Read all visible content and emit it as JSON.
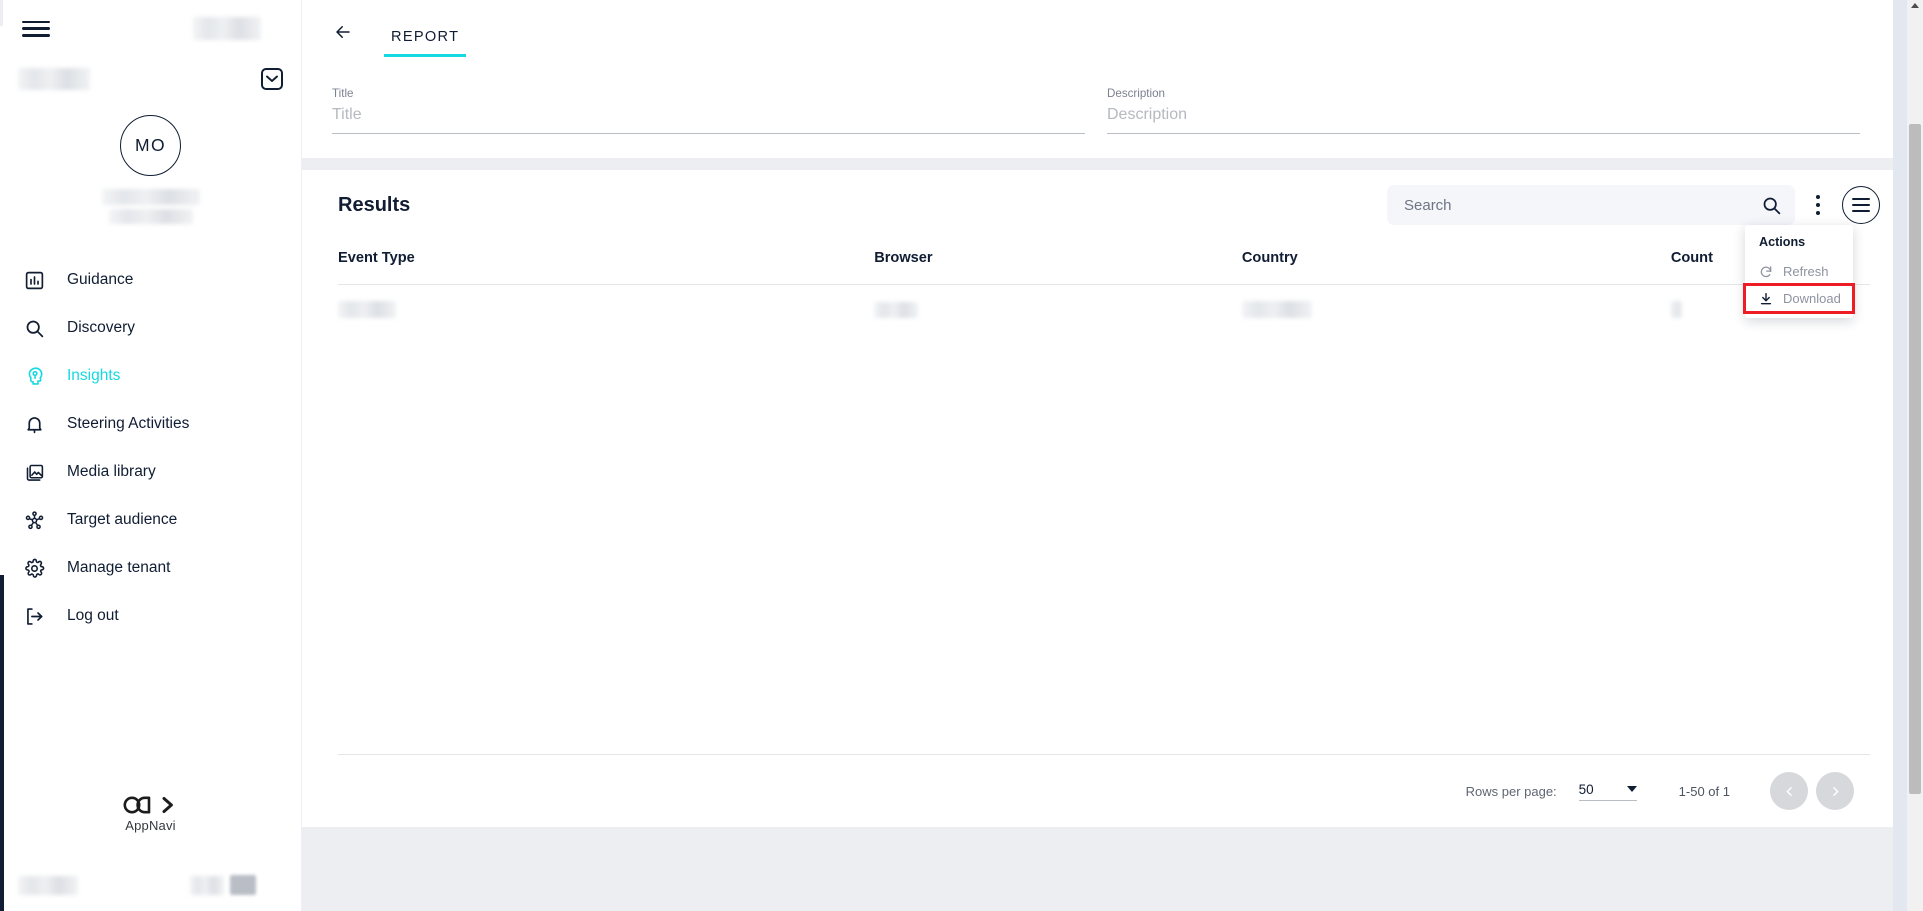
{
  "sidebar": {
    "menu_icon": "hamburger-icon",
    "collapse_icon": "chevron-down-icon",
    "avatar_initials": "MO",
    "items": [
      {
        "label": "Guidance",
        "icon": "bar-chart-icon",
        "active": false
      },
      {
        "label": "Discovery",
        "icon": "search-icon",
        "active": false
      },
      {
        "label": "Insights",
        "icon": "brain-head-icon",
        "active": true
      },
      {
        "label": "Steering Activities",
        "icon": "bell-icon",
        "active": false
      },
      {
        "label": "Media library",
        "icon": "image-gallery-icon",
        "active": false
      },
      {
        "label": "Target audience",
        "icon": "network-nodes-icon",
        "active": false
      },
      {
        "label": "Manage tenant",
        "icon": "gear-icon",
        "active": false
      },
      {
        "label": "Log out",
        "icon": "logout-icon",
        "active": false
      }
    ],
    "logo_text": "AppNavi"
  },
  "header": {
    "back_icon": "arrow-left-icon",
    "tab_label": "REPORT"
  },
  "form": {
    "title_label": "Title",
    "title_placeholder": "Title",
    "title_value": "",
    "description_label": "Description",
    "description_placeholder": "Description",
    "description_value": ""
  },
  "results": {
    "heading": "Results",
    "search_placeholder": "Search",
    "search_value": "",
    "search_icon": "search-icon",
    "kebab_icon": "more-vertical-icon",
    "menu_icon": "hamburger-circle-icon",
    "actions_menu": {
      "title": "Actions",
      "items": [
        {
          "label": "Refresh",
          "icon": "refresh-icon",
          "highlighted": false
        },
        {
          "label": "Download",
          "icon": "download-icon",
          "highlighted": true
        }
      ],
      "highlight_color": "#ee1c25"
    },
    "table": {
      "columns": [
        "Event Type",
        "Browser",
        "Country",
        "Count"
      ],
      "rows": [
        {
          "event_type": "",
          "browser": "",
          "country": "",
          "count": ""
        }
      ]
    }
  },
  "pagination": {
    "rows_per_page_label": "Rows per page:",
    "rows_per_page_value": "50",
    "range_label": "1-50 of 1",
    "prev_icon": "chevron-left-icon",
    "next_icon": "chevron-right-icon"
  },
  "colors": {
    "accent": "#14d9e0",
    "text_dark": "#101d32",
    "muted": "#8d93a0",
    "page_bg": "#eceef2",
    "highlight": "#ee1c25"
  }
}
